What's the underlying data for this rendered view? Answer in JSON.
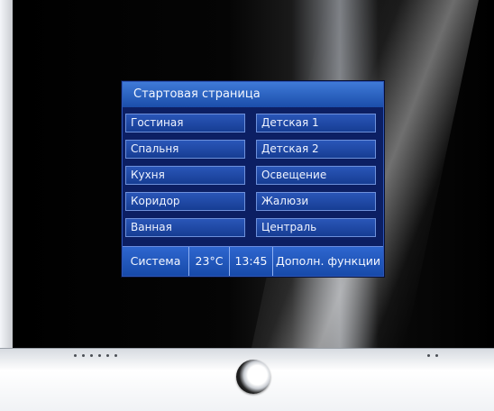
{
  "screen": {
    "title": "Стартовая страница",
    "rooms_left": [
      "Гостиная",
      "Спальня",
      "Кухня",
      "Коридор",
      "Ванная"
    ],
    "rooms_right": [
      "Детская 1",
      "Детская 2",
      "Освещение",
      "Жалюзи",
      "Централь"
    ]
  },
  "status_bar": {
    "system": "Система",
    "temperature": "23°C",
    "time": "13:45",
    "extra": "Дополн. функции"
  },
  "colors": {
    "screen_background": "#0c1f63",
    "title_bar": "#3f7ad8",
    "tile": "#2a56b8"
  }
}
